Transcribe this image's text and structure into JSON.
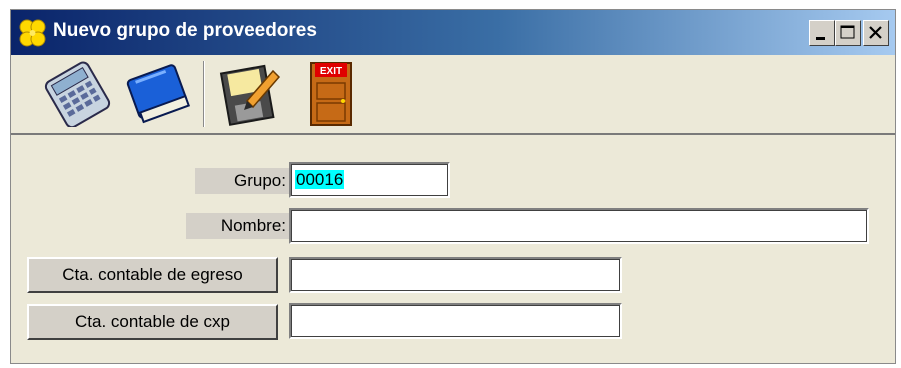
{
  "window": {
    "title": "Nuevo grupo de proveedores",
    "title_icon": "four-leaf-clover-icon",
    "controls": [
      "minimize",
      "maximize",
      "close"
    ]
  },
  "toolbar": {
    "buttons": [
      {
        "name": "calculator",
        "icon": "calculator-icon"
      },
      {
        "name": "book",
        "icon": "book-icon"
      },
      {
        "name": "save",
        "icon": "save-disk-icon"
      },
      {
        "name": "exit",
        "icon": "exit-door-icon",
        "badge": "EXIT"
      }
    ]
  },
  "form": {
    "grupo_label": "Grupo:",
    "grupo_value": "00016",
    "nombre_label": "Nombre:",
    "nombre_value": "",
    "cta_egreso_label": "Cta. contable de egreso",
    "cta_egreso_value": "",
    "cta_cxp_label": "Cta. contable de cxp",
    "cta_cxp_value": ""
  },
  "colors": {
    "title_gradient_start": "#0a246a",
    "title_gradient_end": "#a6caf0",
    "window_bg": "#ece9d8",
    "selection": "#00ffff"
  }
}
